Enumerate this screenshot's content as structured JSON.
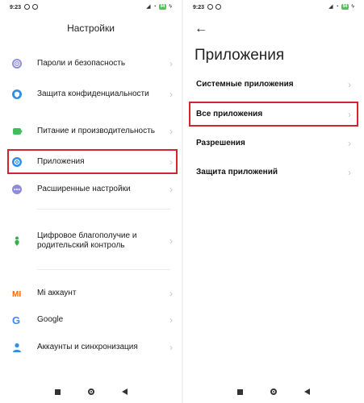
{
  "left": {
    "status_time": "9:23",
    "battery": "94",
    "title": "Настройки",
    "items": [
      {
        "label": "Пароли и безопасность",
        "icon": "fingerprint-icon"
      },
      {
        "label": "Защита конфиденциальности",
        "icon": "shield-icon"
      },
      {
        "label": "Питание и производительность",
        "icon": "battery-icon"
      },
      {
        "label": "Приложения",
        "icon": "gear-icon"
      },
      {
        "label": "Расширенные настройки",
        "icon": "dots-icon"
      },
      {
        "label": "Цифровое благополучие и родительский контроль",
        "icon": "wellbeing-icon"
      },
      {
        "label": "Mi аккаунт",
        "icon": "mi-icon"
      },
      {
        "label": "Google",
        "icon": "google-icon"
      },
      {
        "label": "Аккаунты и синхронизация",
        "icon": "account-icon"
      }
    ]
  },
  "right": {
    "status_time": "9:23",
    "battery": "94",
    "title": "Приложения",
    "items": [
      {
        "label": "Системные приложения"
      },
      {
        "label": "Все приложения"
      },
      {
        "label": "Разрешения"
      },
      {
        "label": "Защита приложений"
      }
    ]
  },
  "colors": {
    "highlight": "#d0262d",
    "battery": "#55c257"
  }
}
